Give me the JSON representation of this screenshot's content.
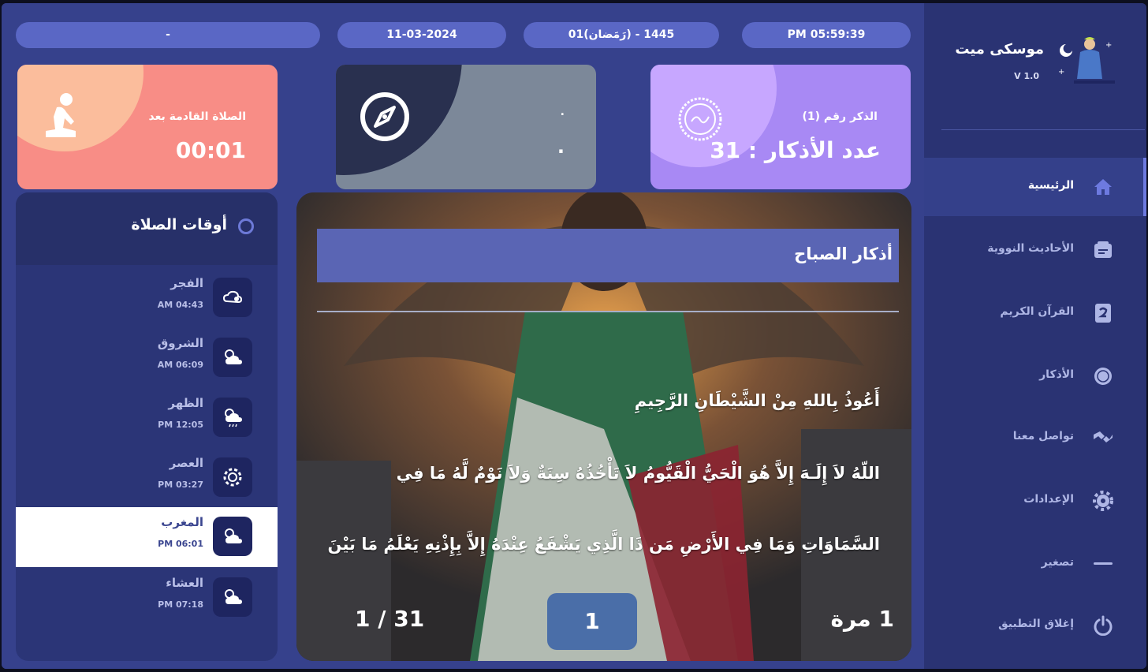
{
  "header": {
    "time": "PM 05:59:39",
    "hijri_date": "1445 - (رَمَضان)01",
    "gregorian_date": "11-03-2024",
    "location": "-"
  },
  "next_prayer_card": {
    "label": "الصلاة القادمة بعد",
    "countdown": "00:01",
    "icon": "praying-person-icon"
  },
  "compass_card": {
    "line1": ".",
    "line2": ".",
    "icon": "compass-icon"
  },
  "dhikr_card": {
    "label": "الذكر رقم (1)",
    "count_text": "عدد الأذكار : 31",
    "icon": "sunnah-seal-icon"
  },
  "prayer_times": {
    "title": "أوقات الصلاة",
    "items": [
      {
        "name": "الفجر",
        "time": "AM 04:43",
        "icon": "cloud-moon-icon"
      },
      {
        "name": "الشروق",
        "time": "AM 06:09",
        "icon": "sun-cloud-icon"
      },
      {
        "name": "الظهر",
        "time": "PM 12:05",
        "icon": "sun-rain-icon"
      },
      {
        "name": "العصر",
        "time": "PM 03:27",
        "icon": "sun-gear-icon"
      },
      {
        "name": "المغرب",
        "time": "PM 06:01",
        "icon": "sun-cloud-icon"
      },
      {
        "name": "العشاء",
        "time": "PM 07:18",
        "icon": "sun-cloud-icon"
      }
    ],
    "active_index": 4
  },
  "dhikr": {
    "title": "أذكار الصباح",
    "verses": [
      "أَعُوذُ بِاللهِ مِنْ الشَّيْطَانِ الرَّجِيمِ",
      "اللّهُ لاَ إِلَـهَ إِلاَّ هُوَ الْحَيُّ الْقَيُّومُ لاَ تَأْخُذُهُ سِنَةٌ وَلاَ نَوْمٌ لَّهُ مَا فِي",
      "السَّمَاوَاتِ وَمَا فِي الأَرْضِ مَن ذَا الَّذِي يَشْفَعُ عِنْدَهُ إِلاَّ بِإِذْنِهِ يَعْلَمُ مَا بَيْنَ"
    ],
    "counter": "1",
    "progress": "1 / 31",
    "repeat": "1 مرة"
  },
  "sidebar": {
    "app_name": "موسكى ميت",
    "version": "V 1.0",
    "items": [
      {
        "label": "الرئيسية",
        "icon": "home-icon"
      },
      {
        "label": "الأحاديث النووية",
        "icon": "hadith-icon"
      },
      {
        "label": "القرآن الكريم",
        "icon": "quran-icon"
      },
      {
        "label": "الأذكار",
        "icon": "dhikr-icon"
      },
      {
        "label": "تواصل معنا",
        "icon": "contact-icon"
      },
      {
        "label": "الإعدادات",
        "icon": "settings-icon"
      },
      {
        "label": "تصغير",
        "icon": "minimize-icon"
      },
      {
        "label": "إغلاق التطبيق",
        "icon": "power-icon"
      }
    ],
    "active_index": 0
  },
  "colors": {
    "background": "#34408a",
    "sidebar": "#2a3373",
    "pill": "#5a67c5",
    "accent": "#6d7ae0"
  }
}
